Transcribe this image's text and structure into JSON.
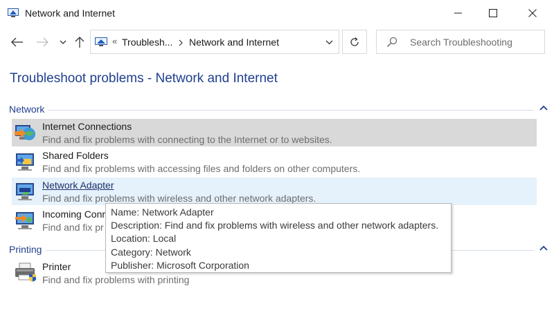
{
  "window": {
    "title": "Network and Internet"
  },
  "address": {
    "chevrons": "«",
    "crumbs": [
      "Troublesh...",
      "Network and Internet"
    ]
  },
  "search": {
    "placeholder": "Search Troubleshooting"
  },
  "page_title": "Troubleshoot problems - Network and Internet",
  "groups": [
    {
      "title": "Network",
      "items": [
        {
          "name": "Internet Connections",
          "desc": "Find and fix problems with connecting to the Internet or to websites.",
          "icon": "internet-connections-icon"
        },
        {
          "name": "Shared Folders",
          "desc": "Find and fix problems with accessing files and folders on other computers.",
          "icon": "shared-folders-icon"
        },
        {
          "name": "Network Adapter",
          "desc": "Find and fix problems with wireless and other network adapters.",
          "icon": "network-adapter-icon"
        },
        {
          "name": "Incoming Conn",
          "desc": "Find and fix pr",
          "icon": "incoming-connections-icon"
        }
      ]
    },
    {
      "title": "Printing",
      "items": [
        {
          "name": "Printer",
          "desc": "Find and fix problems with printing",
          "icon": "printer-icon"
        }
      ]
    }
  ],
  "tooltip": {
    "lines": [
      "Name: Network Adapter",
      "Description: Find and fix problems with wireless and other network adapters.",
      "Location: Local",
      "Category: Network",
      "Publisher: Microsoft Corporation"
    ]
  },
  "colors": {
    "accent": "#1f3f8f",
    "hover_gray": "#d9d9d9",
    "hover_blue": "#e5f1fb"
  }
}
